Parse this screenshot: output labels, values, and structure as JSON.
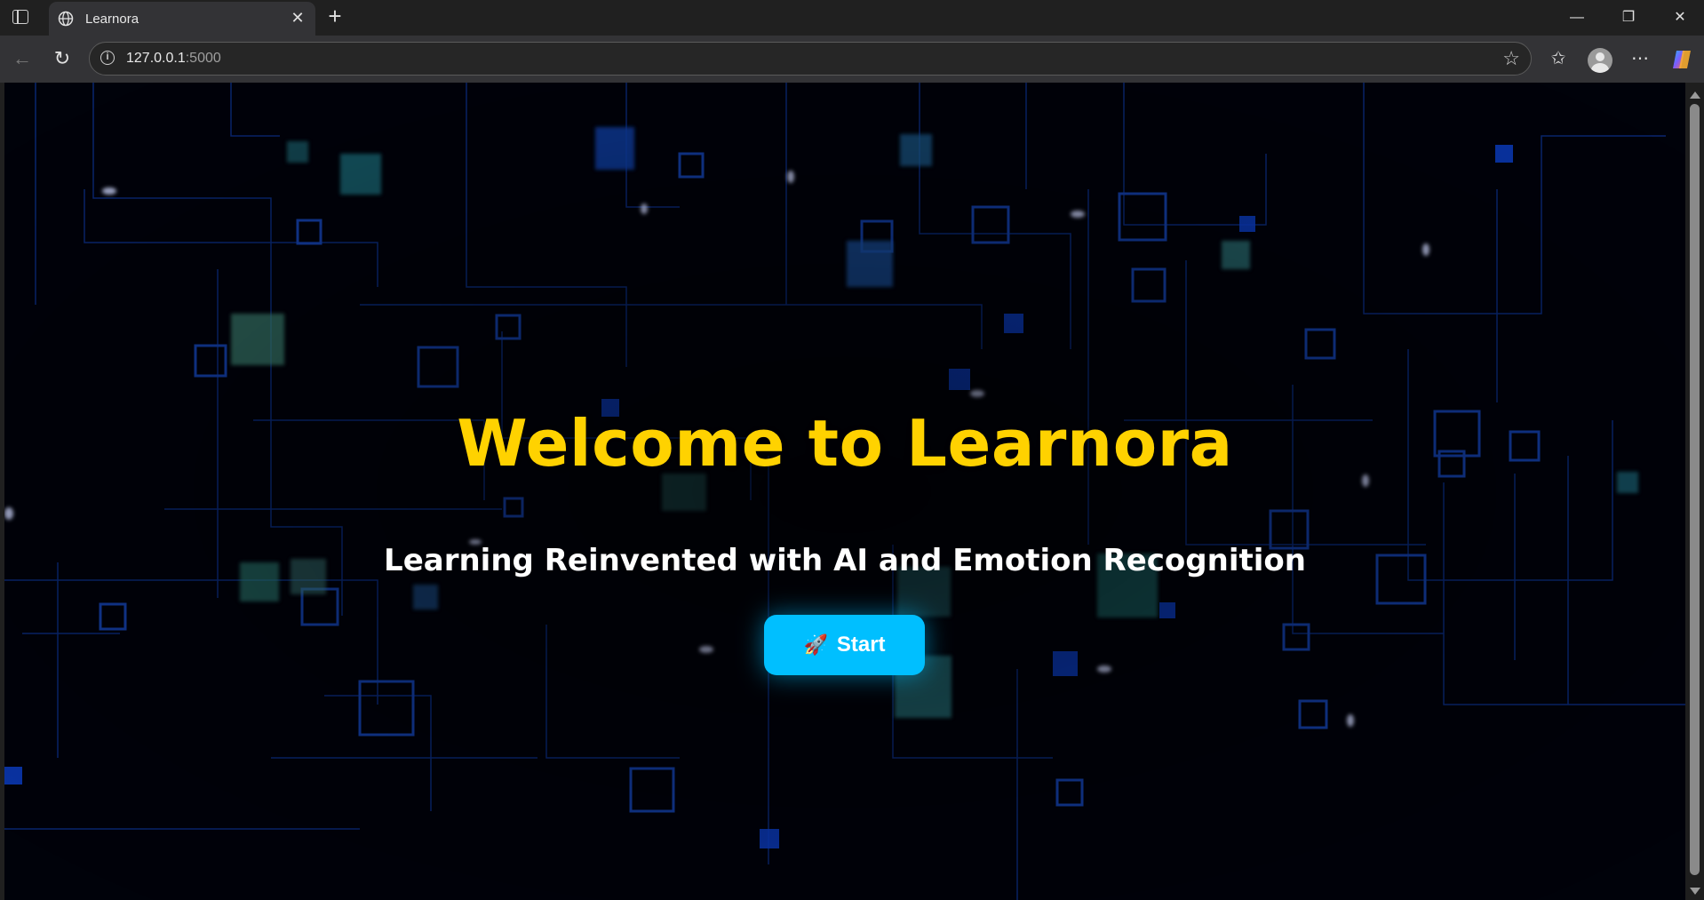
{
  "browser": {
    "tab_title": "Learnora",
    "tab_close": "✕",
    "new_tab": "+",
    "url_host": "127.0.0.1",
    "url_port": ":5000",
    "window_controls": {
      "minimize": "—",
      "restore": "❐",
      "close": "✕"
    },
    "icons": [
      "sidebar-toggle-icon",
      "globe-icon",
      "back-icon",
      "refresh-icon",
      "info-icon",
      "star-icon",
      "favorites-icon",
      "profile-icon",
      "more-icon",
      "copilot-icon"
    ]
  },
  "page": {
    "title": "Welcome to Learnora",
    "subtitle": "Learning Reinvented with AI and Emotion Recognition",
    "start_icon": "🚀",
    "start_label": "Start",
    "colors": {
      "title": "#ffd200",
      "subtitle": "#ffffff",
      "button": "#00bfff",
      "background": "#000006",
      "circuit": "#1a4fd0"
    }
  }
}
